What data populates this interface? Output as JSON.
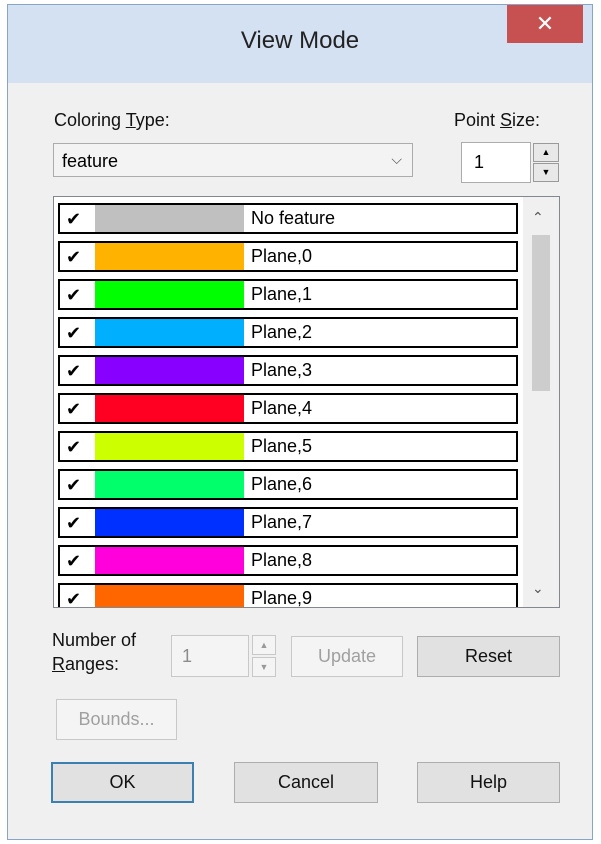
{
  "window": {
    "title": "View Mode",
    "close_glyph": "✕"
  },
  "coloring_type": {
    "label_prefix": "Coloring ",
    "label_mnemonic": "T",
    "label_suffix": "ype:",
    "selected": "feature"
  },
  "point_size": {
    "label_prefix": "Point ",
    "label_mnemonic": "S",
    "label_suffix": "ize:",
    "value": "1"
  },
  "features": {
    "items": [
      {
        "label": "No feature",
        "color": "#c0c0c0",
        "checked": true
      },
      {
        "label": "Plane,0",
        "color": "#ffb300",
        "checked": true
      },
      {
        "label": "Plane,1",
        "color": "#00ff00",
        "checked": true
      },
      {
        "label": "Plane,2",
        "color": "#00b0ff",
        "checked": true
      },
      {
        "label": "Plane,3",
        "color": "#8800ff",
        "checked": true
      },
      {
        "label": "Plane,4",
        "color": "#ff0022",
        "checked": true
      },
      {
        "label": "Plane,5",
        "color": "#ccff00",
        "checked": true
      },
      {
        "label": "Plane,6",
        "color": "#00ff6a",
        "checked": true
      },
      {
        "label": "Plane,7",
        "color": "#0030ff",
        "checked": true
      },
      {
        "label": "Plane,8",
        "color": "#ff00dd",
        "checked": true
      },
      {
        "label": "Plane,9",
        "color": "#ff6600",
        "checked": true
      }
    ]
  },
  "ranges": {
    "label_line1": "Number of",
    "label_line2_mnemonic": "R",
    "label_line2_suffix": "anges:",
    "value": "1"
  },
  "buttons": {
    "update": "Update",
    "reset": "Reset",
    "bounds": "Bounds...",
    "ok": "OK",
    "cancel": "Cancel",
    "help": "Help"
  }
}
